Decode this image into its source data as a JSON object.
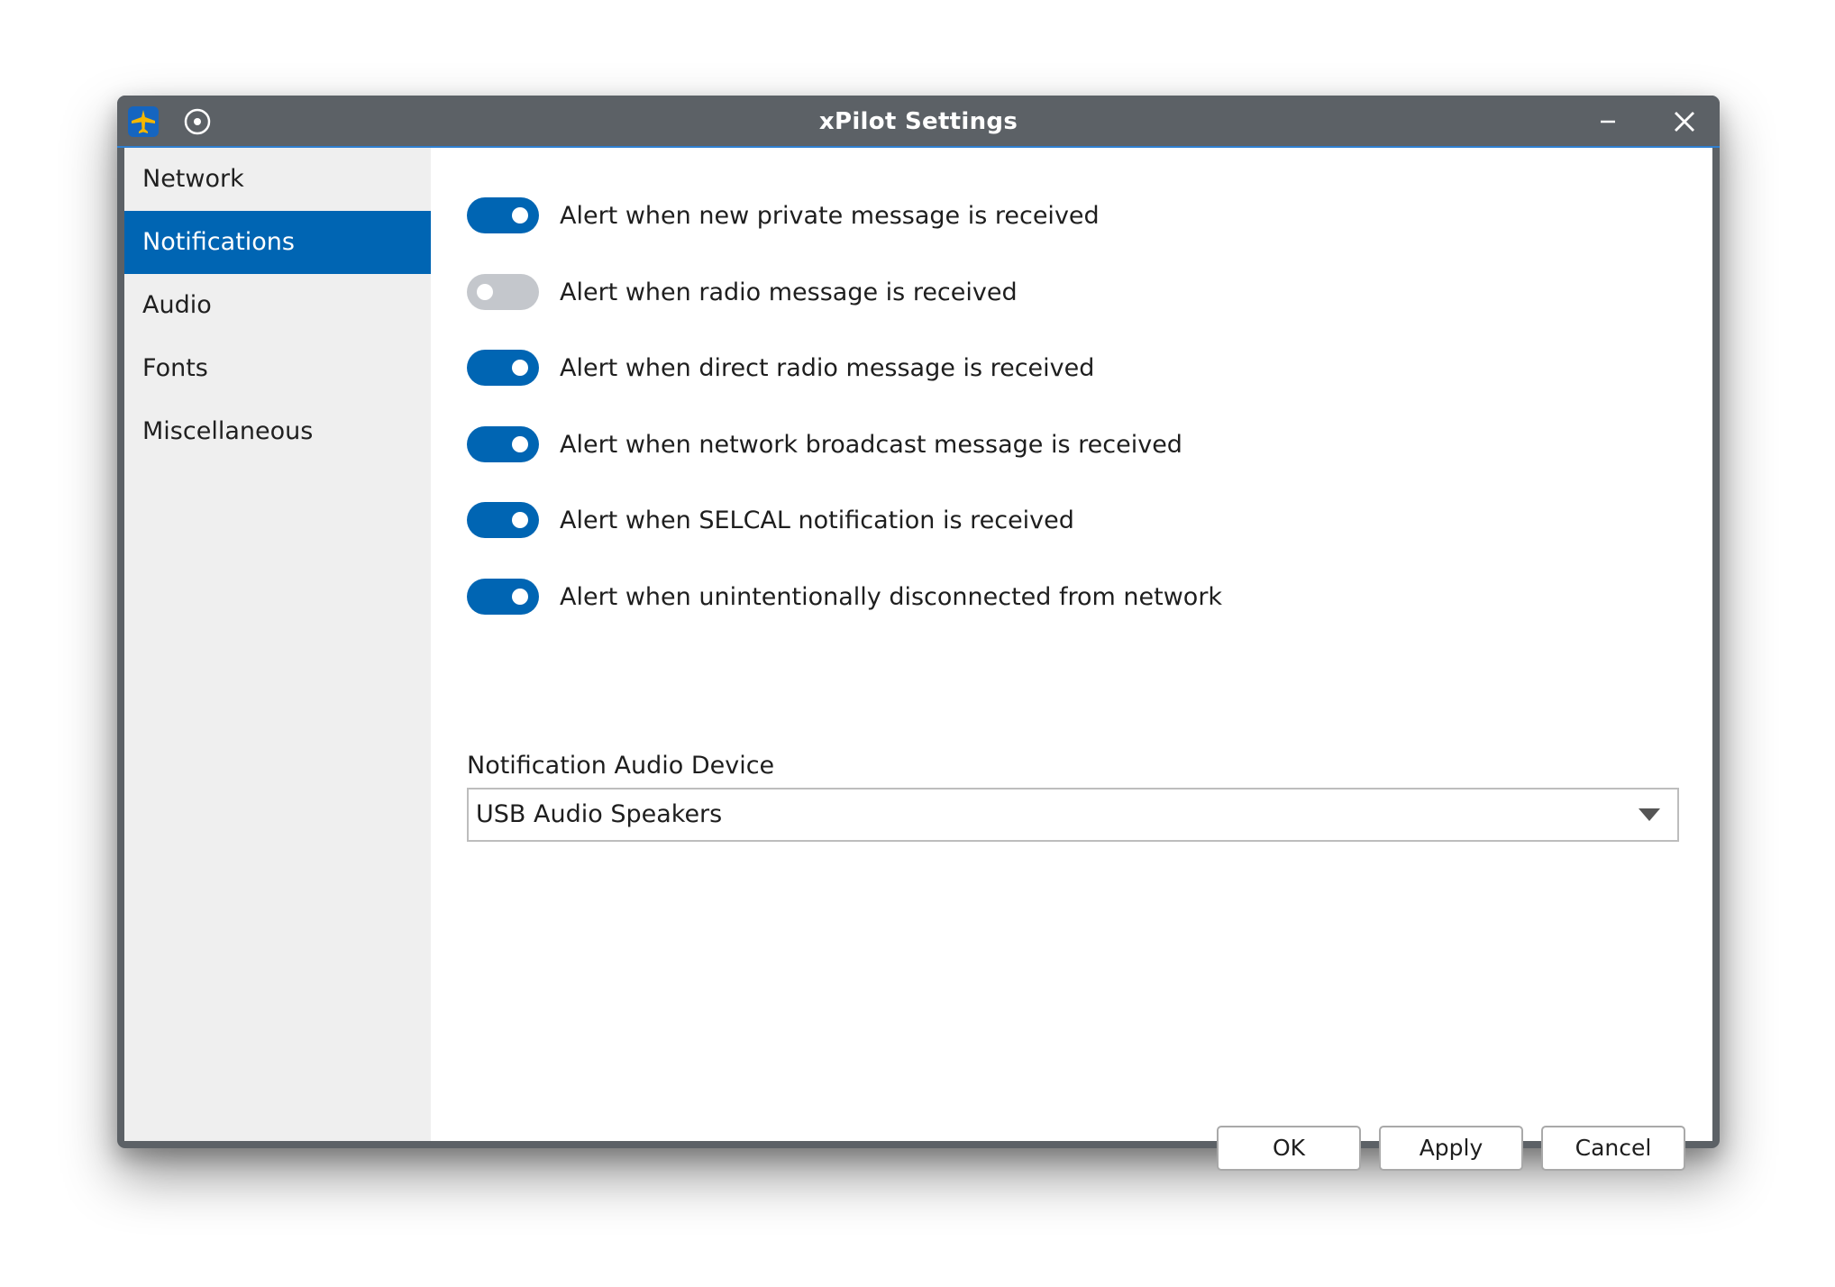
{
  "window": {
    "title": "xPilot Settings",
    "app_icon": "airplane-icon",
    "pin_icon": "pin-icon",
    "minimize_icon": "minimize-icon",
    "close_icon": "close-icon"
  },
  "sidebar": {
    "items": [
      {
        "label": "Network",
        "active": false
      },
      {
        "label": "Notifications",
        "active": true
      },
      {
        "label": "Audio",
        "active": false
      },
      {
        "label": "Fonts",
        "active": false
      },
      {
        "label": "Miscellaneous",
        "active": false
      }
    ]
  },
  "notifications": {
    "toggles": [
      {
        "label": "Alert when new private message is received",
        "on": true
      },
      {
        "label": "Alert when radio message is received",
        "on": false
      },
      {
        "label": "Alert when direct radio message is received",
        "on": true
      },
      {
        "label": "Alert when network broadcast message is received",
        "on": true
      },
      {
        "label": "Alert when SELCAL notification is received",
        "on": true
      },
      {
        "label": "Alert when unintentionally disconnected from network",
        "on": true
      }
    ],
    "audio_device_label": "Notification Audio Device",
    "audio_device_value": "USB Audio Speakers"
  },
  "buttons": {
    "ok": "OK",
    "apply": "Apply",
    "cancel": "Cancel"
  },
  "colors": {
    "accent": "#0065b3",
    "titlebar": "#5c6166",
    "toggle_off": "#c4c7cc",
    "sidebar_bg": "#efefef",
    "logo_yellow": "#f5b700",
    "logo_blue": "#1565c0"
  }
}
